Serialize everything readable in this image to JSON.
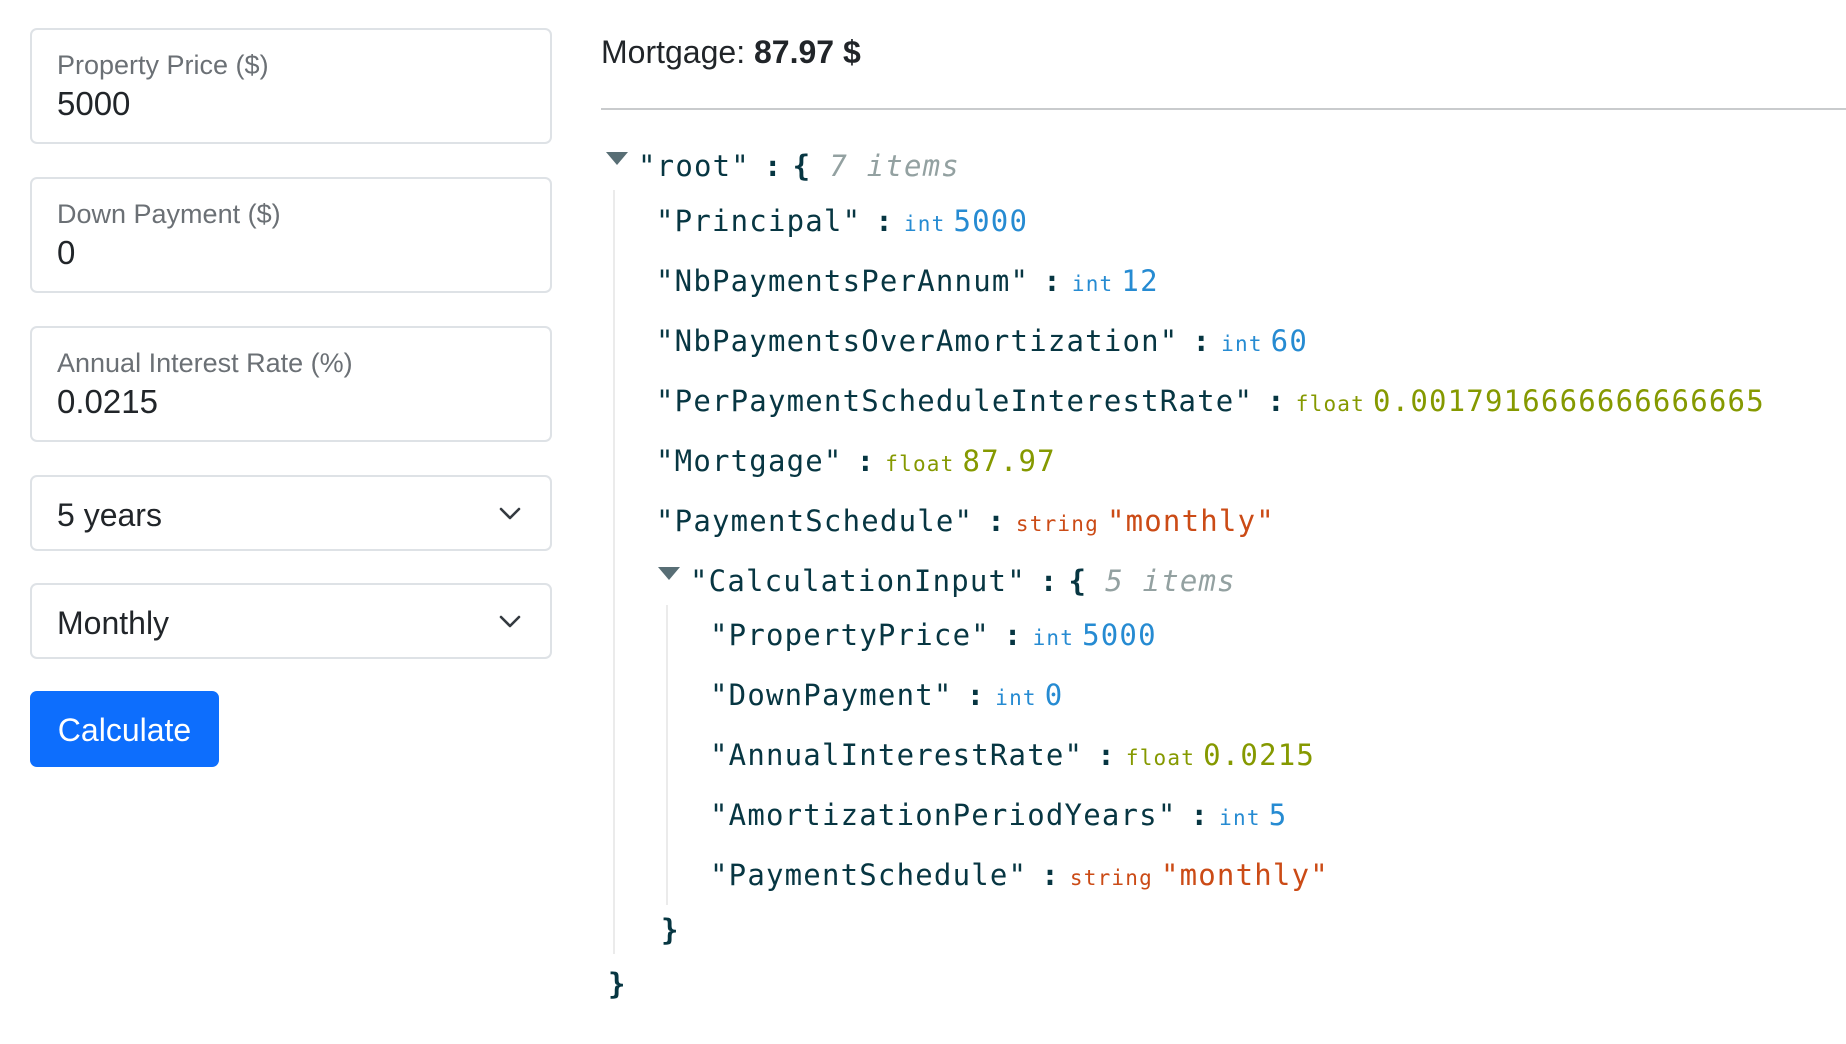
{
  "form": {
    "property_price": {
      "label": "Property Price ($)",
      "value": "5000"
    },
    "down_payment": {
      "label": "Down Payment ($)",
      "value": "0"
    },
    "interest_rate": {
      "label": "Annual Interest Rate (%)",
      "value": "0.0215"
    },
    "amortization_select": {
      "value": "5 years"
    },
    "schedule_select": {
      "value": "Monthly"
    },
    "calculate_label": "Calculate"
  },
  "result": {
    "mortgage_label": "Mortgage:",
    "mortgage_value": "87.97 $"
  },
  "json_view": {
    "root_key": "\"root\"",
    "colon": ":",
    "open_brace": "{",
    "close_brace": "}",
    "root_count": "7 items",
    "entries": [
      {
        "key": "\"Principal\"",
        "type": "int",
        "value": "5000"
      },
      {
        "key": "\"NbPaymentsPerAnnum\"",
        "type": "int",
        "value": "12"
      },
      {
        "key": "\"NbPaymentsOverAmortization\"",
        "type": "int",
        "value": "60"
      },
      {
        "key": "\"PerPaymentScheduleInterestRate\"",
        "type": "float",
        "value": "0.0017916666666666665"
      },
      {
        "key": "\"Mortgage\"",
        "type": "float",
        "value": "87.97"
      },
      {
        "key": "\"PaymentSchedule\"",
        "type": "string",
        "value": "\"monthly\""
      }
    ],
    "nested_key": "\"CalculationInput\"",
    "nested_count": "5 items",
    "nested_entries": [
      {
        "key": "\"PropertyPrice\"",
        "type": "int",
        "value": "5000"
      },
      {
        "key": "\"DownPayment\"",
        "type": "int",
        "value": "0"
      },
      {
        "key": "\"AnnualInterestRate\"",
        "type": "float",
        "value": "0.0215"
      },
      {
        "key": "\"AmortizationPeriodYears\"",
        "type": "int",
        "value": "5"
      },
      {
        "key": "\"PaymentSchedule\"",
        "type": "string",
        "value": "\"monthly\""
      }
    ]
  },
  "colors": {
    "accent": "#0d6efd",
    "int": "#268bd2",
    "float": "#859900",
    "string": "#cb4b16",
    "key": "#073642",
    "muted": "#93a1a1"
  },
  "icons": {
    "select_chevron": "chevron-down-icon",
    "expand_toggle": "caret-down-icon"
  }
}
